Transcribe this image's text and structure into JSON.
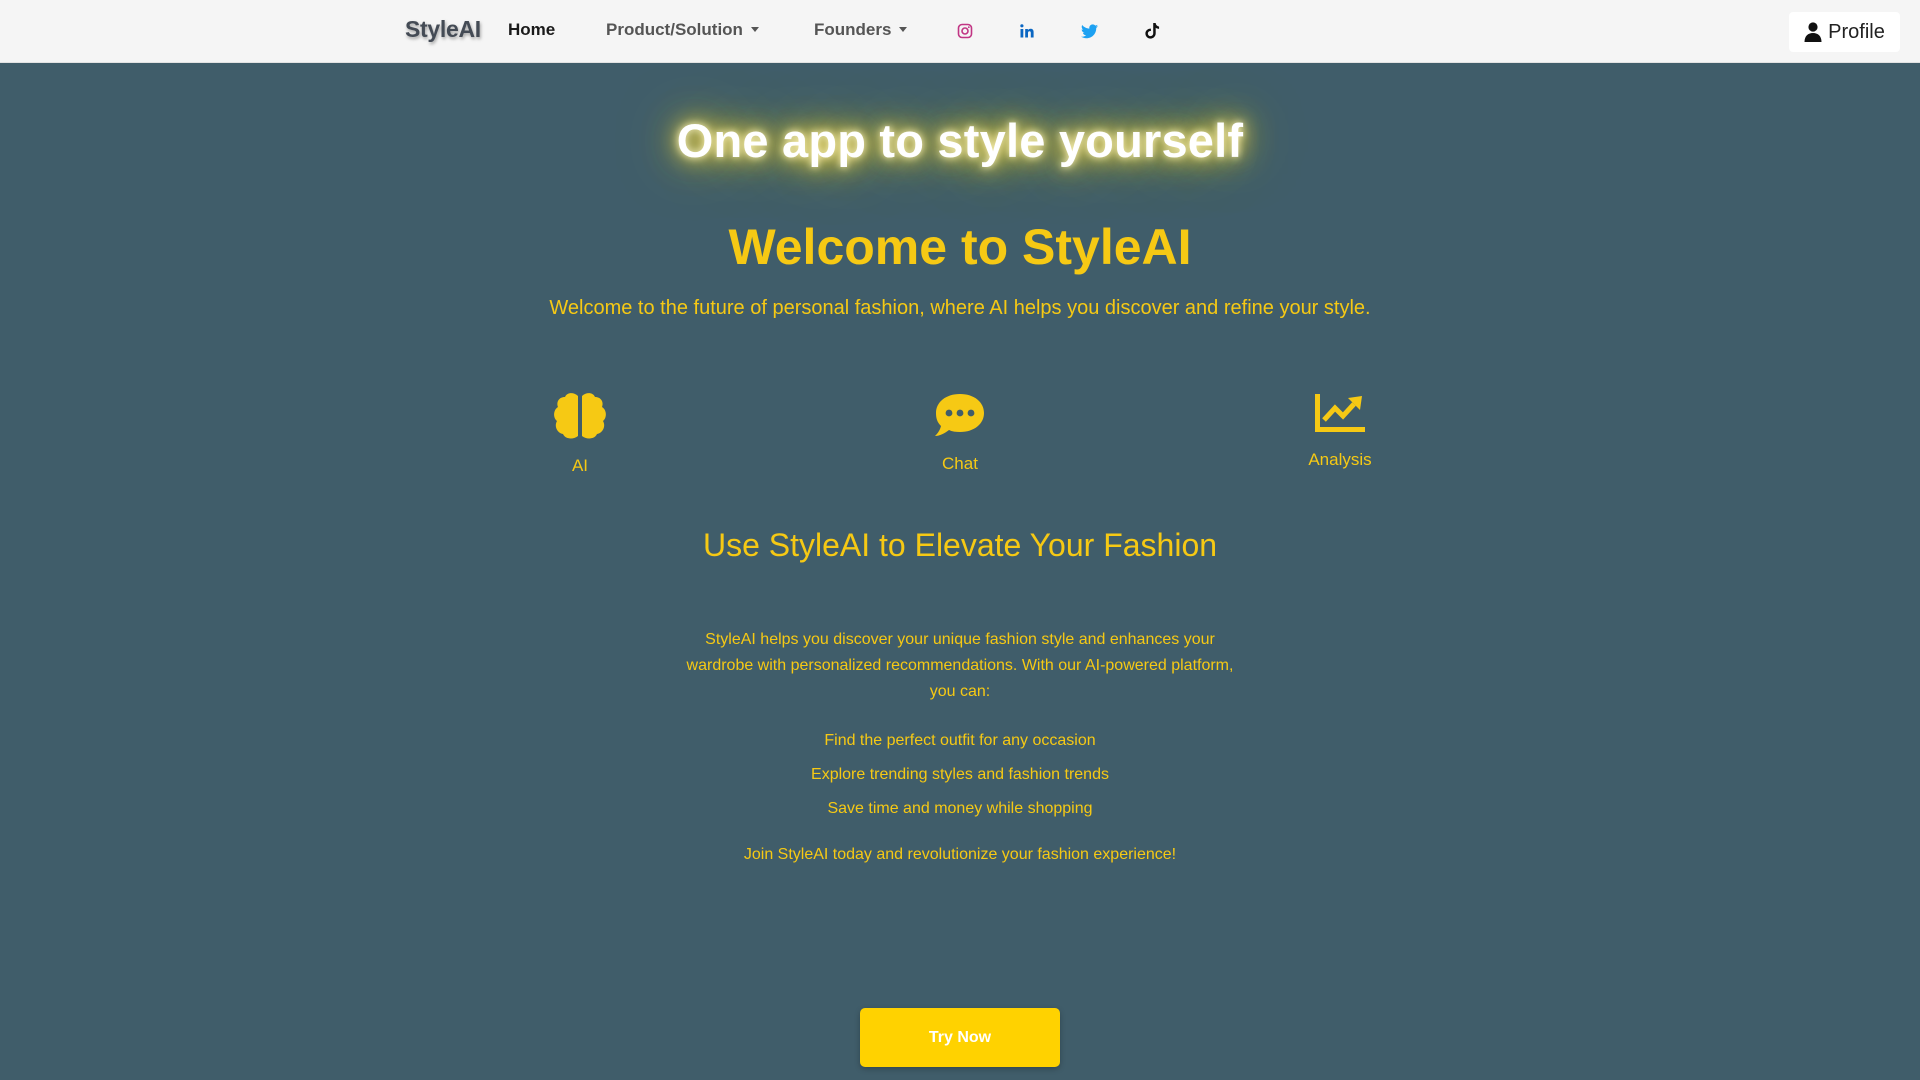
{
  "navbar": {
    "brand": "StyleAI",
    "links": [
      {
        "label": "Home"
      },
      {
        "label": "Product/Solution"
      },
      {
        "label": "Founders"
      }
    ],
    "social_icons": [
      "instagram-icon",
      "linkedin-icon",
      "twitter-icon",
      "tiktok-icon"
    ],
    "profile_label": "Profile"
  },
  "hero": {
    "glow_title": "One app to style yourself",
    "welcome_title": "Welcome to StyleAI",
    "tagline": "Welcome to the future of personal fashion, where AI helps you discover and refine your style."
  },
  "features": [
    {
      "icon": "brain-icon",
      "label": "AI"
    },
    {
      "icon": "chat-icon",
      "label": "Chat"
    },
    {
      "icon": "chart-line-icon",
      "label": "Analysis"
    }
  ],
  "section": {
    "title": "Use StyleAI to Elevate Your Fashion",
    "body": "StyleAI helps you discover your unique fashion style and enhances your wardrobe with personalized recommendations. With our AI-powered platform, you can:",
    "bullets": [
      "Find the perfect outfit for any occasion",
      "Explore trending styles and fashion trends",
      "Save time and money while shopping"
    ],
    "join": "Join StyleAI today and revolutionize your fashion experience!"
  },
  "cta": {
    "label": "Try Now"
  },
  "colors": {
    "background": "#405d6a",
    "accent": "#f6c914",
    "button": "#ffd200",
    "navbar": "#f5f5f5"
  }
}
